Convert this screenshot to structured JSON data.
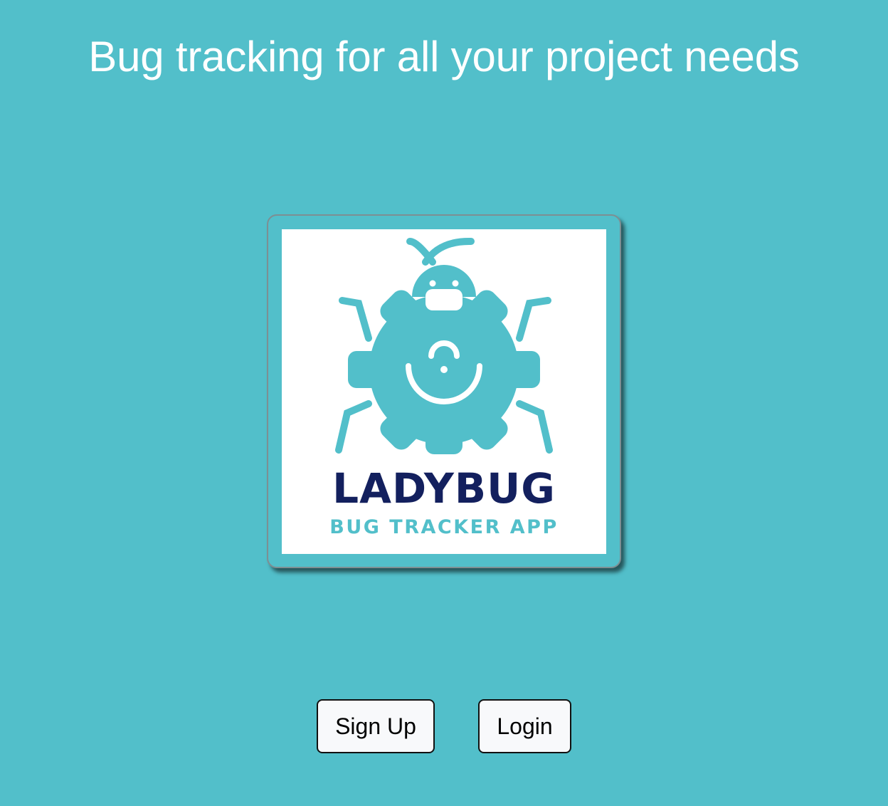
{
  "hero": {
    "headline": "Bug tracking for all your project needs"
  },
  "logo": {
    "name": "LADYBUG",
    "tagline": "BUG TRACKER APP",
    "icon": "bug-gear-icon",
    "colors": {
      "teal": "#52bfca",
      "navy": "#13205e"
    }
  },
  "actions": {
    "signup_label": "Sign Up",
    "login_label": "Login"
  },
  "colors": {
    "background": "#52bfca",
    "headline_text": "#ffffff",
    "button_background": "#f8f9fb",
    "button_border": "#111111"
  }
}
